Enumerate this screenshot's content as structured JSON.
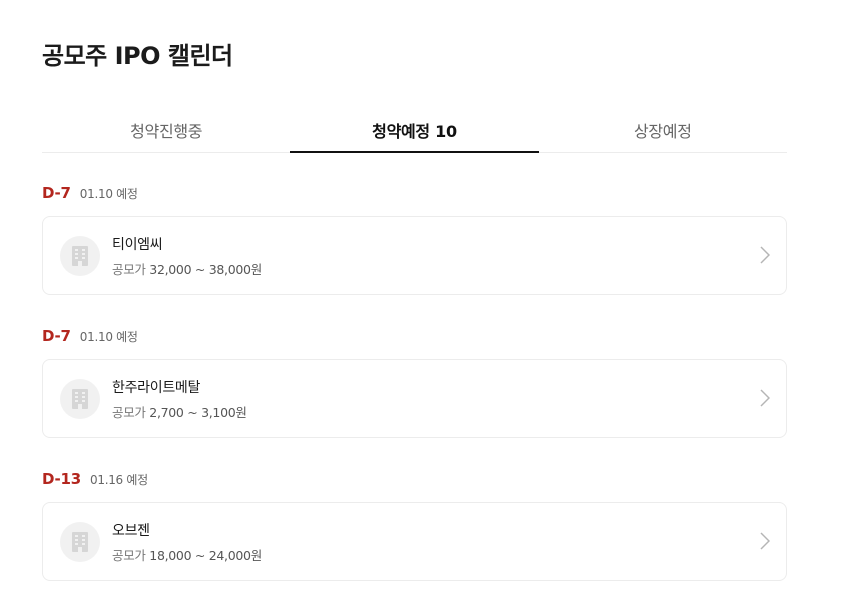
{
  "header": {
    "title": "공모주 IPO 캘린더"
  },
  "tabs": [
    {
      "label": "청약진행중",
      "active": false
    },
    {
      "label": "청약예정 10",
      "active": true
    },
    {
      "label": "상장예정",
      "active": false
    }
  ],
  "groups": [
    {
      "dday": "D-7",
      "date": "01.10 예정",
      "company": "티이엠씨",
      "price_label": "공모가",
      "price": "32,000 ~ 38,000원",
      "logo_icon": "building-icon",
      "arrow_icon": "chevron-right-icon"
    },
    {
      "dday": "D-7",
      "date": "01.10 예정",
      "company": "한주라이트메탈",
      "price_label": "공모가",
      "price": "2,700 ~ 3,100원",
      "logo_icon": "building-icon",
      "arrow_icon": "chevron-right-icon"
    },
    {
      "dday": "D-13",
      "date": "01.16 예정",
      "company": "오브젠",
      "price_label": "공모가",
      "price": "18,000 ~ 24,000원",
      "logo_icon": "building-icon",
      "arrow_icon": "chevron-right-icon"
    }
  ],
  "colors": {
    "dday": "#b3261e",
    "active_tab_underline": "#111111",
    "card_border": "#ececec",
    "logo_bg": "#f1f1f1"
  }
}
